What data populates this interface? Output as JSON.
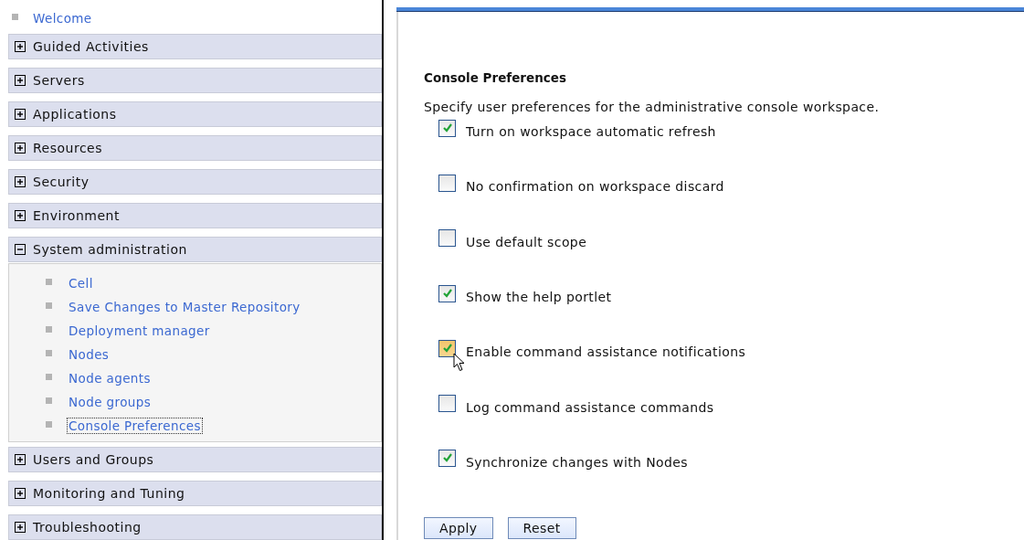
{
  "nav": {
    "top_link": "Welcome",
    "sections": [
      {
        "label": "Guided Activities",
        "expanded": false
      },
      {
        "label": "Servers",
        "expanded": false
      },
      {
        "label": "Applications",
        "expanded": false
      },
      {
        "label": "Resources",
        "expanded": false
      },
      {
        "label": "Security",
        "expanded": false
      },
      {
        "label": "Environment",
        "expanded": false
      },
      {
        "label": "System administration",
        "expanded": true,
        "children": [
          {
            "label": "Cell",
            "focused": false
          },
          {
            "label": "Save Changes to Master Repository",
            "focused": false
          },
          {
            "label": "Deployment manager",
            "focused": false
          },
          {
            "label": "Nodes",
            "focused": false
          },
          {
            "label": "Node agents",
            "focused": false
          },
          {
            "label": "Node groups",
            "focused": false
          },
          {
            "label": "Console Preferences",
            "focused": true
          }
        ]
      },
      {
        "label": "Users and Groups",
        "expanded": false
      },
      {
        "label": "Monitoring and Tuning",
        "expanded": false
      },
      {
        "label": "Troubleshooting",
        "expanded": false
      }
    ]
  },
  "content": {
    "title": "Console Preferences",
    "description": "Specify user preferences for the administrative console workspace.",
    "options": [
      {
        "label": "Turn on workspace automatic refresh",
        "checked": true,
        "hovered": false
      },
      {
        "label": "No confirmation on workspace discard",
        "checked": false,
        "hovered": false
      },
      {
        "label": "Use default scope",
        "checked": false,
        "hovered": false
      },
      {
        "label": "Show the help portlet",
        "checked": true,
        "hovered": false
      },
      {
        "label": "Enable command assistance notifications",
        "checked": true,
        "hovered": true
      },
      {
        "label": "Log command assistance commands",
        "checked": false,
        "hovered": false
      },
      {
        "label": "Synchronize changes with Nodes",
        "checked": true,
        "hovered": false
      }
    ],
    "buttons": [
      "Apply",
      "Reset"
    ]
  }
}
